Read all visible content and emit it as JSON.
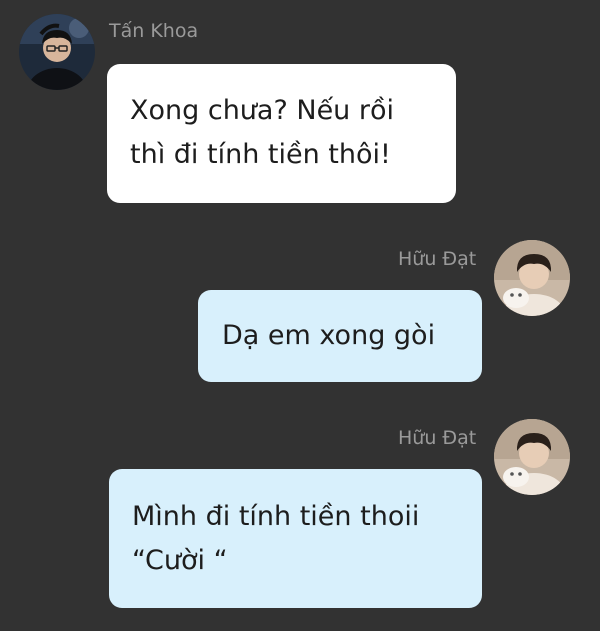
{
  "chat": {
    "messages": [
      {
        "sender": "Tấn Khoa",
        "direction": "incoming",
        "avatar_icon": "user-avatar-icon",
        "lines": [
          "Xong chưa? Nếu rồi",
          "thì đi tính tiền thôi!"
        ]
      },
      {
        "sender": "Hữu Đạt",
        "direction": "outgoing",
        "avatar_icon": "user-avatar-icon",
        "lines": [
          "Dạ em xong gòi"
        ]
      },
      {
        "sender": "Hữu Đạt",
        "direction": "outgoing",
        "avatar_icon": "user-avatar-icon",
        "lines": [
          "Mình đi tính tiền thoii",
          "“Cười “"
        ]
      }
    ]
  },
  "colors": {
    "background": "#323232",
    "incoming_bubble": "#ffffff",
    "outgoing_bubble": "#d8f0fc",
    "sender_name": "#9a9a9a",
    "message_text": "#1d1d1d"
  }
}
